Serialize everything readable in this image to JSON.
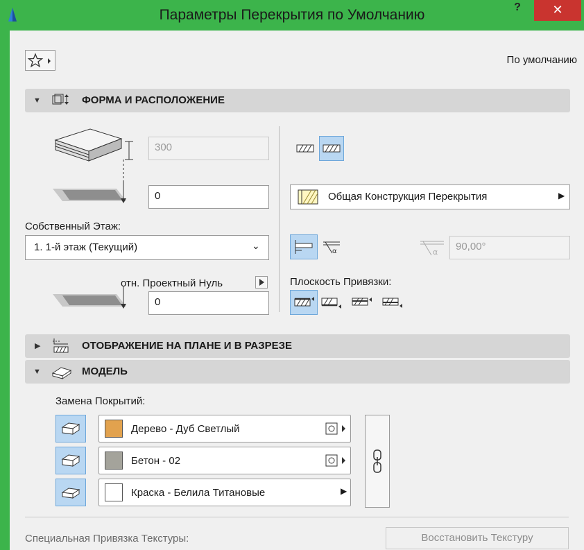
{
  "window": {
    "title": "Параметры Перекрытия по Умолчанию",
    "help": "?",
    "close": "✕"
  },
  "header": {
    "default_label": "По умолчанию"
  },
  "section_geometry": {
    "label": "ФОРМА И РАСПОЛОЖЕНИЕ",
    "thickness_value": "300",
    "offset_value": "0",
    "home_story_label": "Собственный Этаж:",
    "home_story_value": "1. 1-й этаж (Текущий)",
    "project_zero_label": "отн. Проектный Нуль",
    "project_zero_value": "0",
    "structure_value": "Общая Конструкция Перекрытия",
    "angle_value": "90,00°",
    "reference_plane_label": "Плоскость Привязки:"
  },
  "section_floorplan": {
    "label": "ОТОБРАЖЕНИЕ НА ПЛАНЕ И В РАЗРЕЗЕ"
  },
  "section_model": {
    "label": "МОДЕЛЬ",
    "override_label": "Замена Покрытий:",
    "materials": [
      {
        "name": "Дерево - Дуб Светлый",
        "color": "#e2a24e"
      },
      {
        "name": "Бетон - 02",
        "color": "#a4a39b"
      },
      {
        "name": "Краска - Белила Титановые",
        "color": "#ffffff"
      }
    ],
    "texture_label": "Специальная Привязка Текстуры:",
    "restore_label": "Восстановить Текстуру"
  }
}
